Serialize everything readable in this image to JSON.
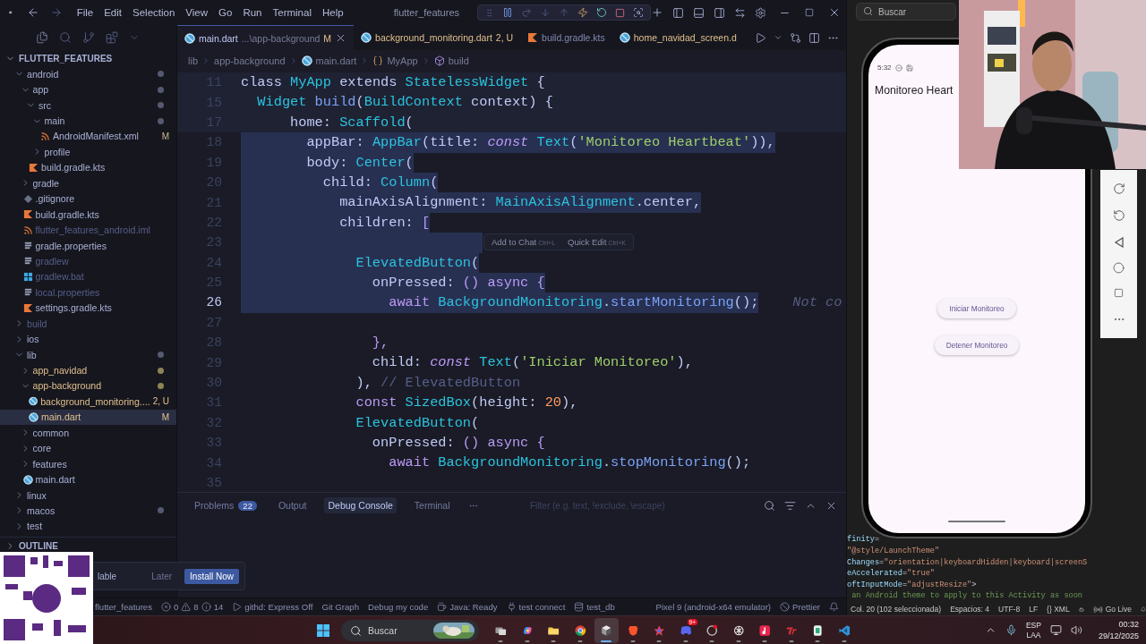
{
  "title_bar": {
    "menu": [
      "File",
      "Edit",
      "Selection",
      "View",
      "Go",
      "Run",
      "Terminal",
      "Help"
    ],
    "title": "flutter_features"
  },
  "sidebar": {
    "title": "FLUTTER_FEATURES",
    "outline": "OUTLINE",
    "tree": [
      {
        "label": "android",
        "kind": "folder",
        "expanded": true,
        "dot": true,
        "selected": false,
        "children": [
          {
            "label": "app",
            "kind": "folder",
            "expanded": true,
            "dot": true,
            "selected": false,
            "children": [
              {
                "label": "src",
                "kind": "folder",
                "expanded": true,
                "dot": true,
                "selected": false,
                "children": [
                  {
                    "label": "main",
                    "kind": "folder",
                    "expanded": true,
                    "dot": true,
                    "selected": false,
                    "children": [
                      {
                        "label": "AndroidManifest.xml",
                        "kind": "xml",
                        "badge": "M",
                        "selected": false
                      }
                    ]
                  },
                  {
                    "label": "profile",
                    "kind": "folder",
                    "expanded": false,
                    "dot": false,
                    "selected": false
                  }
                ]
              },
              {
                "label": "build.gradle.kts",
                "kind": "gradle",
                "selected": false
              }
            ]
          },
          {
            "label": "gradle",
            "kind": "folder",
            "expanded": false,
            "dot": false,
            "selected": false
          },
          {
            "label": ".gitignore",
            "kind": "git",
            "selected": false
          },
          {
            "label": "build.gradle.kts",
            "kind": "gradle",
            "selected": false
          },
          {
            "label": "flutter_features_android.iml",
            "kind": "xml",
            "color": "#565f89",
            "selected": false
          },
          {
            "label": "gradle.properties",
            "kind": "text",
            "selected": false
          },
          {
            "label": "gradlew",
            "kind": "text",
            "color": "#565f89",
            "selected": false
          },
          {
            "label": "gradlew.bat",
            "kind": "windows",
            "color": "#565f89",
            "selected": false
          },
          {
            "label": "local.properties",
            "kind": "text",
            "color": "#565f89",
            "selected": false
          },
          {
            "label": "settings.gradle.kts",
            "kind": "gradle",
            "selected": false
          }
        ]
      },
      {
        "label": "build",
        "kind": "folder",
        "expanded": false,
        "dot": false,
        "color": "#565f89",
        "selected": false
      },
      {
        "label": "ios",
        "kind": "folder",
        "expanded": false,
        "dot": false,
        "selected": false
      },
      {
        "label": "lib",
        "kind": "folder",
        "expanded": true,
        "dot": true,
        "selected": false,
        "children": [
          {
            "label": "app_navidad",
            "kind": "folder",
            "expanded": false,
            "dot": true,
            "color": "#e0c08d",
            "selected": false
          },
          {
            "label": "app-background",
            "kind": "folder",
            "expanded": true,
            "dot": true,
            "color": "#e0c08d",
            "selected": false,
            "children": [
              {
                "label": "background_monitoring....",
                "kind": "dart",
                "color": "#e0c08d",
                "badge": "2, U",
                "selected": false
              },
              {
                "label": "main.dart",
                "kind": "dart",
                "color": "#e0c08d",
                "badge": "M",
                "selected": true
              }
            ]
          },
          {
            "label": "common",
            "kind": "folder",
            "expanded": false,
            "dot": false,
            "selected": false
          },
          {
            "label": "core",
            "kind": "folder",
            "expanded": false,
            "dot": false,
            "selected": false
          },
          {
            "label": "features",
            "kind": "folder",
            "expanded": false,
            "dot": false,
            "selected": false
          },
          {
            "label": "main.dart",
            "kind": "dart",
            "selected": false
          }
        ]
      },
      {
        "label": "linux",
        "kind": "folder",
        "expanded": false,
        "dot": false,
        "selected": false
      },
      {
        "label": "macos",
        "kind": "folder",
        "expanded": false,
        "dot": true,
        "selected": false
      },
      {
        "label": "test",
        "kind": "folder",
        "expanded": false,
        "dot": false,
        "selected": false
      }
    ]
  },
  "editor": {
    "tabs": [
      {
        "label": "main.dart",
        "description": "...\\app-background",
        "badge": "M",
        "kind": "dart",
        "selected": true
      },
      {
        "label": "background_monitoring.dart",
        "badge": "2, U",
        "kind": "dart",
        "color": "#e0c08d",
        "selected": false
      },
      {
        "label": "build.gradle.kts",
        "kind": "gradle",
        "selected": false
      },
      {
        "label": "home_navidad_screen.d",
        "kind": "dart",
        "color": "#e0c08d",
        "selected": false
      }
    ],
    "breadcrumbs": [
      {
        "label": "lib",
        "kind": "plain"
      },
      {
        "label": "app-background",
        "kind": "plain"
      },
      {
        "label": "main.dart",
        "kind": "dart"
      },
      {
        "label": "MyApp",
        "kind": "class"
      },
      {
        "label": "build",
        "kind": "method"
      }
    ],
    "lines": [
      {
        "number": "11",
        "sticky": true,
        "selected": false,
        "tokens": [
          {
            "kind": "plain",
            "text": "class "
          },
          {
            "kind": "type",
            "text": "MyApp"
          },
          {
            "kind": "plain",
            "text": " extends "
          },
          {
            "kind": "type",
            "text": "StatelessWidget"
          },
          {
            "kind": "plain",
            "text": " {"
          }
        ]
      },
      {
        "number": "15",
        "sticky": true,
        "selected": false,
        "tokens": [
          {
            "kind": "type",
            "text": "  Widget"
          },
          {
            "kind": "function",
            "text": " build"
          },
          {
            "kind": "plain",
            "text": "("
          },
          {
            "kind": "type",
            "text": "BuildContext"
          },
          {
            "kind": "plain",
            "text": " context) {"
          }
        ]
      },
      {
        "number": "17",
        "sticky": true,
        "selected": false,
        "tokens": [
          {
            "kind": "plain",
            "text": "      home: "
          },
          {
            "kind": "type",
            "text": "Scaffold"
          },
          {
            "kind": "plain",
            "text": "("
          }
        ]
      },
      {
        "number": "18",
        "sticky": false,
        "selected": true,
        "tokens": [
          {
            "kind": "plain",
            "text": "        appBar: "
          },
          {
            "kind": "type",
            "text": "AppBar"
          },
          {
            "kind": "plain",
            "text": "(title: "
          },
          {
            "kind": "modifier",
            "text": "const "
          },
          {
            "kind": "type",
            "text": "Text"
          },
          {
            "kind": "plain",
            "text": "("
          },
          {
            "kind": "string",
            "text": "'Monitoreo Heartbeat'"
          },
          {
            "kind": "plain",
            "text": ")),"
          }
        ]
      },
      {
        "number": "19",
        "sticky": false,
        "selected": true,
        "tokens": [
          {
            "kind": "plain",
            "text": "        body: "
          },
          {
            "kind": "type",
            "text": "Center"
          },
          {
            "kind": "plain",
            "text": "("
          }
        ]
      },
      {
        "number": "20",
        "sticky": false,
        "selected": true,
        "tokens": [
          {
            "kind": "plain",
            "text": "          child: "
          },
          {
            "kind": "type",
            "text": "Column"
          },
          {
            "kind": "plain",
            "text": "("
          }
        ]
      },
      {
        "number": "21",
        "sticky": false,
        "selected": true,
        "tokens": [
          {
            "kind": "plain",
            "text": "            mainAxisAlignment: "
          },
          {
            "kind": "type",
            "text": "MainAxisAlignment"
          },
          {
            "kind": "plain",
            "text": ".center,"
          }
        ]
      },
      {
        "number": "22",
        "sticky": false,
        "selected": true,
        "tokens": [
          {
            "kind": "plain",
            "text": "            children: "
          },
          {
            "kind": "keyword",
            "text": "["
          }
        ]
      },
      {
        "number": "23",
        "sticky": false,
        "selected": true
      },
      {
        "number": "24",
        "sticky": false,
        "selected": true,
        "tokens": [
          {
            "kind": "type",
            "text": "              ElevatedButton"
          },
          {
            "kind": "plain",
            "text": "("
          }
        ]
      },
      {
        "number": "25",
        "sticky": false,
        "selected": true,
        "tokens": [
          {
            "kind": "plain",
            "text": "                onPressed: "
          },
          {
            "kind": "keyword",
            "text": "() async {"
          }
        ]
      },
      {
        "number": "26",
        "sticky": false,
        "selected": true,
        "tokens": [
          {
            "kind": "keyword",
            "text": "                  await "
          },
          {
            "kind": "type",
            "text": "BackgroundMonitoring"
          },
          {
            "kind": "plain",
            "text": "."
          },
          {
            "kind": "function",
            "text": "startMonitoring"
          },
          {
            "kind": "plain",
            "text": "();"
          }
        ],
        "hint": "Not co"
      },
      {
        "number": "27",
        "sticky": false,
        "selected": false
      },
      {
        "number": "28",
        "sticky": false,
        "selected": false,
        "tokens": [
          {
            "kind": "keyword",
            "text": "                },"
          }
        ]
      },
      {
        "number": "29",
        "sticky": false,
        "selected": false,
        "tokens": [
          {
            "kind": "plain",
            "text": "                child: "
          },
          {
            "kind": "modifier",
            "text": "const "
          },
          {
            "kind": "type",
            "text": "Text"
          },
          {
            "kind": "plain",
            "text": "("
          },
          {
            "kind": "string",
            "text": "'Iniciar Monitoreo'"
          },
          {
            "kind": "plain",
            "text": "),"
          }
        ]
      },
      {
        "number": "30",
        "sticky": false,
        "selected": false,
        "tokens": [
          {
            "kind": "plain",
            "text": "              ), "
          },
          {
            "kind": "comment",
            "text": "// ElevatedButton"
          }
        ]
      },
      {
        "number": "31",
        "sticky": false,
        "selected": false,
        "tokens": [
          {
            "kind": "keyword",
            "text": "              const "
          },
          {
            "kind": "type",
            "text": "SizedBox"
          },
          {
            "kind": "plain",
            "text": "(height: "
          },
          {
            "kind": "number",
            "text": "20"
          },
          {
            "kind": "plain",
            "text": "),"
          }
        ]
      },
      {
        "number": "32",
        "sticky": false,
        "selected": false,
        "tokens": [
          {
            "kind": "type",
            "text": "              ElevatedButton"
          },
          {
            "kind": "plain",
            "text": "("
          }
        ]
      },
      {
        "number": "33",
        "sticky": false,
        "selected": false,
        "tokens": [
          {
            "kind": "plain",
            "text": "                onPressed: "
          },
          {
            "kind": "keyword",
            "text": "() async {"
          }
        ]
      },
      {
        "number": "34",
        "sticky": false,
        "selected": false,
        "tokens": [
          {
            "kind": "keyword",
            "text": "                  await "
          },
          {
            "kind": "type",
            "text": "BackgroundMonitoring"
          },
          {
            "kind": "plain",
            "text": "."
          },
          {
            "kind": "function",
            "text": "stopMonitoring"
          },
          {
            "kind": "plain",
            "text": "();"
          }
        ]
      },
      {
        "number": "35",
        "sticky": false,
        "selected": false
      }
    ],
    "hover": [
      {
        "label": "Add to Chat",
        "shortcut": "Ctrl+L"
      },
      {
        "label": "Quick Edit",
        "shortcut": "Ctrl+K"
      }
    ]
  },
  "panel": {
    "tabs": [
      {
        "label": "Problems",
        "count": "22",
        "selected": false
      },
      {
        "label": "Output",
        "selected": false
      },
      {
        "label": "Debug Console",
        "selected": true
      },
      {
        "label": "Terminal",
        "selected": false
      }
    ],
    "filter_placeholder": "Filter (e.g. text, !exclude, \\escape)"
  },
  "notification": {
    "message": "lable",
    "buttons": [
      {
        "label": "Later",
        "primary": false
      },
      {
        "label": "Install Now",
        "primary": true
      }
    ]
  },
  "status_bar": {
    "left": [
      {
        "kind": "plain",
        "text": "flutter_features"
      },
      {
        "kind": "problems",
        "errors": "0",
        "warnings": "8",
        "infos": "14"
      },
      {
        "kind": "githd",
        "text": "githd: Express Off"
      },
      {
        "kind": "plain",
        "text": "Git Graph"
      },
      {
        "kind": "plain",
        "text": "Debug my code"
      },
      {
        "kind": "java",
        "text": "Java: Ready"
      },
      {
        "kind": "plug",
        "text": "test connect"
      },
      {
        "kind": "database",
        "text": "test_db"
      }
    ],
    "right": [
      {
        "kind": "plain",
        "text": "Pixel 9 (android-x64 emulator)"
      },
      {
        "kind": "prettier",
        "text": "Prettier"
      },
      {
        "kind": "bell"
      }
    ]
  },
  "side_window": {
    "search_placeholder": "Buscar",
    "code": [
      [
        {
          "kind": "attribute",
          "text": "finity"
        },
        {
          "kind": "operator",
          "text": "="
        }
      ],
      [
        {
          "kind": "string",
          "text": "\"@style/LaunchTheme\""
        }
      ],
      [
        {
          "kind": "attribute",
          "text": "Changes"
        },
        {
          "kind": "operator",
          "text": "="
        },
        {
          "kind": "string",
          "text": "\"orientation|keyboardHidden|keyboard|screenS"
        }
      ],
      [
        {
          "kind": "attribute",
          "text": "eAccelerated"
        },
        {
          "kind": "operator",
          "text": "="
        },
        {
          "kind": "string",
          "text": "\"true\""
        }
      ],
      [
        {
          "kind": "attribute",
          "text": "oftInputMode"
        },
        {
          "kind": "operator",
          "text": "="
        },
        {
          "kind": "string",
          "text": "\"adjustResize\""
        },
        {
          "kind": "operator",
          "text": ">"
        }
      ],
      [
        {
          "kind": "comment",
          "text": " an Android theme to apply to this Activity as soon"
        }
      ]
    ],
    "status": [
      {
        "kind": "plain",
        "text": "Col. 20 (102 seleccionada)"
      },
      {
        "kind": "plain",
        "text": "Espacios: 4"
      },
      {
        "kind": "plain",
        "text": "UTF-8"
      },
      {
        "kind": "plain",
        "text": "LF"
      },
      {
        "kind": "plain",
        "text": "{} XML"
      },
      {
        "kind": "copilot"
      },
      {
        "kind": "golive",
        "text": "Go Live"
      },
      {
        "kind": "bell"
      }
    ]
  },
  "emulator": {
    "time": "5:32",
    "app_title": "Monitoreo Heart",
    "buttons": [
      "Iniciar Monitoreo",
      "Detener Monitoreo"
    ]
  },
  "taskbar": {
    "search_placeholder": "Buscar",
    "apps": [
      {
        "kind": "task-view",
        "selected": false
      },
      {
        "kind": "copilot",
        "selected": false
      },
      {
        "kind": "files",
        "selected": false
      },
      {
        "kind": "chrome",
        "selected": false
      },
      {
        "kind": "cube",
        "selected": true
      },
      {
        "kind": "brave",
        "selected": false
      },
      {
        "kind": "star",
        "selected": false
      },
      {
        "kind": "discord",
        "badge": "9+",
        "selected": false
      },
      {
        "kind": "dot-app",
        "selected": false
      },
      {
        "kind": "knot",
        "selected": false
      },
      {
        "kind": "music",
        "selected": false
      },
      {
        "kind": "tile",
        "selected": false
      },
      {
        "kind": "leaf",
        "selected": false
      },
      {
        "kind": "vscode",
        "selected": false
      }
    ],
    "language": "ESP",
    "layout": "LAA",
    "time": "00:32",
    "date": "29/12/2025"
  }
}
